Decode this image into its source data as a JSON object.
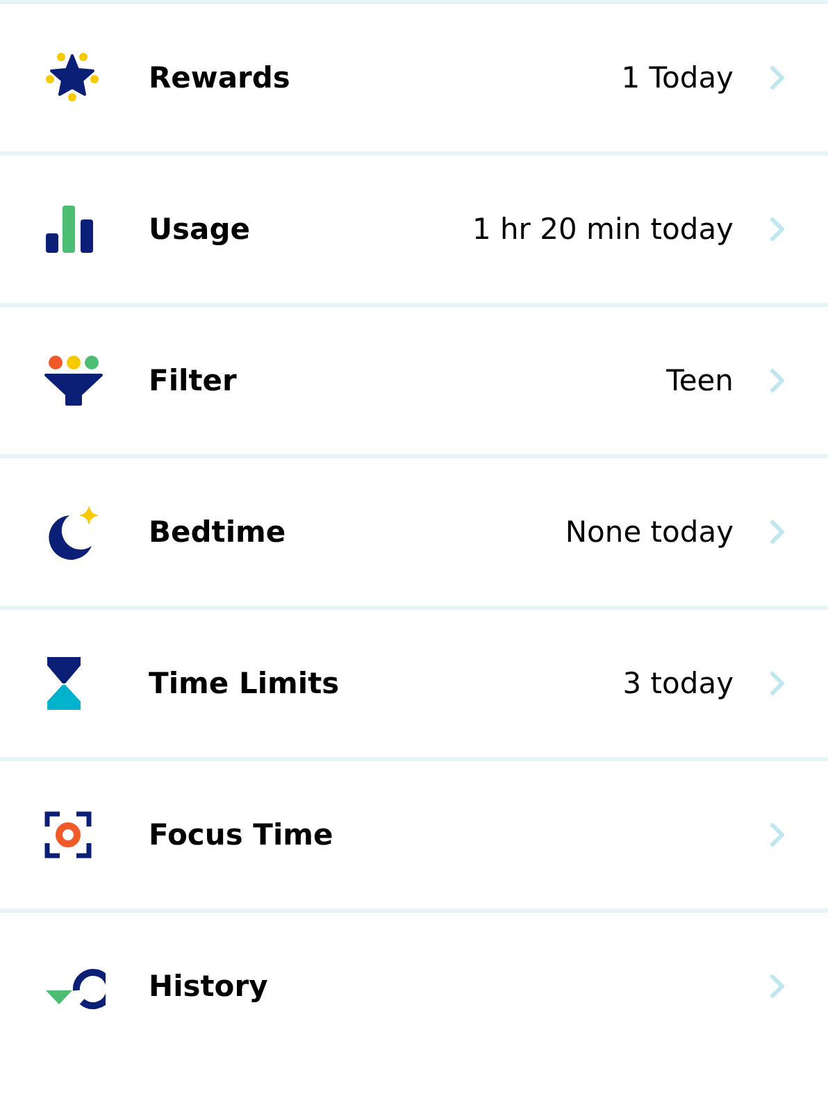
{
  "rows": [
    {
      "kind": "rewards",
      "label": "Rewards",
      "value": "1 Today"
    },
    {
      "kind": "usage",
      "label": "Usage",
      "value": "1 hr 20 min today"
    },
    {
      "kind": "filter",
      "label": "Filter",
      "value": "Teen"
    },
    {
      "kind": "bedtime",
      "label": "Bedtime",
      "value": "None today"
    },
    {
      "kind": "limits",
      "label": "Time Limits",
      "value": "3 today"
    },
    {
      "kind": "focus",
      "label": "Focus Time"
    },
    {
      "kind": "history",
      "label": "History"
    }
  ]
}
